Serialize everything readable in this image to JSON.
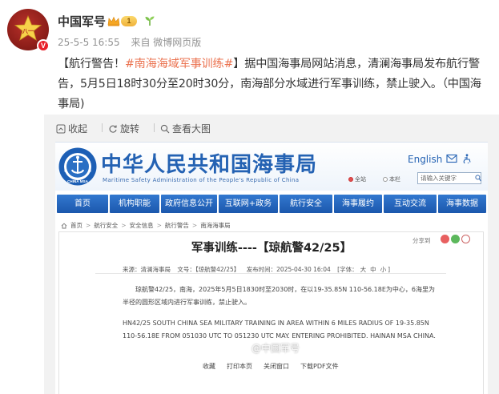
{
  "post": {
    "author": "中国军号",
    "level": "1",
    "date": "25-5-5 16:55",
    "source": "来自 微博网页版",
    "text_prefix": "【航行警告！",
    "topic": "#南海海域军事训练#",
    "text_main": "】据中国海事局网站消息，清澜海事局发布航行警告，5月5日18时30分至20时30分，南海部分水域进行军事训练，禁止驶入。（中国海事局)"
  },
  "image_toolbar": {
    "collapse": "收起",
    "rotate": "旋转",
    "view_large": "查看大图"
  },
  "msa_page": {
    "title_cn": "中华人民共和国海事局",
    "title_en": "Maritime Safety Administration of the People's Republic of China",
    "logo_text": "CHINA MSA",
    "english_link": "English",
    "search_scope_site": "全站",
    "search_scope_column": "本栏",
    "search_placeholder": "请输入关键字",
    "nav": [
      "首页",
      "机构职能",
      "政府信息公开",
      "互联网+政务",
      "航行安全",
      "海事履约",
      "互动交流",
      "海事数据"
    ],
    "breadcrumb": [
      "首页",
      "航行安全",
      "安全信息",
      "航行警告",
      "南海海事局"
    ],
    "share_label": "分享到",
    "article": {
      "title": "军事训练----【琼航警42/25】",
      "meta": [
        "来源：清澜海事局",
        "文号：【琼航警42/25】",
        "发布时间：2025-04-30 16:04",
        "[字体：",
        "大",
        "中",
        "小",
        "]"
      ],
      "para_cn": "琼航警42/25，南海，2025年5月5日1830时至2030时，在以19-35.85N 110-56.18E为中心，6海里为半径的圆形区域内进行军事训练，禁止驶入。",
      "para_en": "HN42/25 SOUTH CHINA SEA MILITARY TRAINING IN AREA WITHIN 6 MILES RADIUS OF 19-35.85N 110-56.18E FROM 051030 UTC TO 051230 UTC MAY. ENTERING PROHIBITED. HAINAN MSA CHINA.",
      "actions": [
        "收藏",
        "打印本页",
        "关闭窗口",
        "下载PDF文件"
      ]
    }
  },
  "watermark": "@中国军号",
  "colors": {
    "topic": "#eb7350",
    "msa_blue": "#2462b3",
    "nav_blue": "#1c58ad"
  }
}
